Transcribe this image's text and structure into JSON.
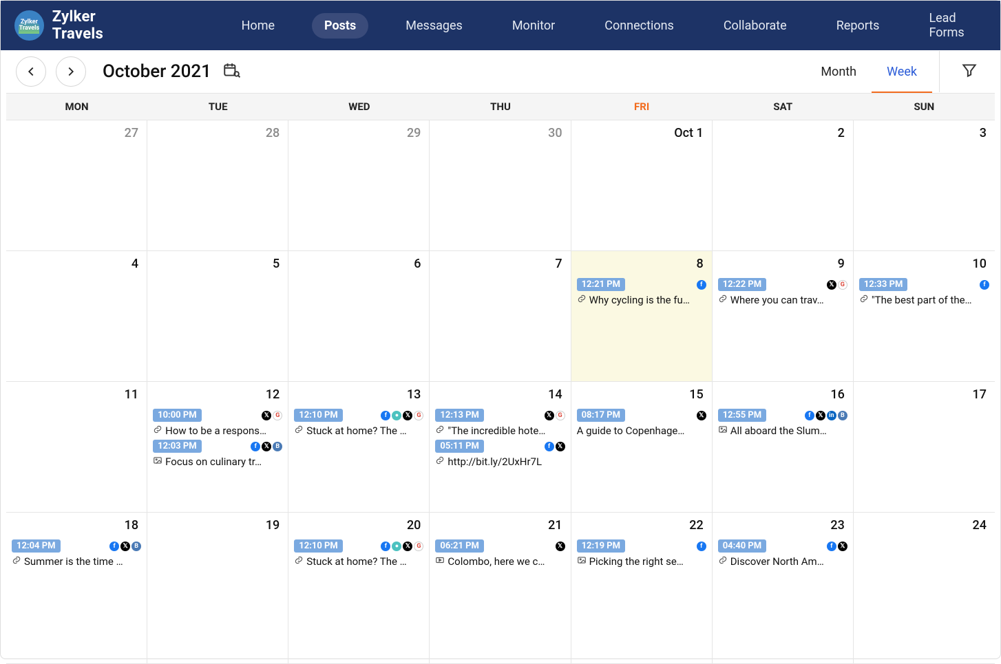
{
  "brand": {
    "name": "Zylker Travels",
    "logo_text": "Zylker Travels"
  },
  "nav": {
    "items": [
      "Home",
      "Posts",
      "Messages",
      "Monitor",
      "Connections",
      "Collaborate",
      "Reports",
      "Lead Forms"
    ],
    "active_index": 1
  },
  "subbar": {
    "title": "October 2021",
    "view_month": "Month",
    "view_week": "Week",
    "active_view_index": 1
  },
  "weekdays": [
    "MON",
    "TUE",
    "WED",
    "THU",
    "FRI",
    "SAT",
    "SUN"
  ],
  "today_weekday_index": 4,
  "grid": [
    [
      {
        "date": "27",
        "current": false,
        "posts": []
      },
      {
        "date": "28",
        "current": false,
        "posts": []
      },
      {
        "date": "29",
        "current": false,
        "posts": []
      },
      {
        "date": "30",
        "current": false,
        "posts": []
      },
      {
        "date": "Oct 1",
        "current": true,
        "posts": []
      },
      {
        "date": "2",
        "current": true,
        "posts": []
      },
      {
        "date": "3",
        "current": true,
        "posts": []
      }
    ],
    [
      {
        "date": "4",
        "current": true,
        "posts": []
      },
      {
        "date": "5",
        "current": true,
        "posts": []
      },
      {
        "date": "6",
        "current": true,
        "posts": []
      },
      {
        "date": "7",
        "current": true,
        "posts": []
      },
      {
        "date": "8",
        "current": true,
        "highlight": true,
        "posts": [
          {
            "time": "12:21 PM",
            "icons": [
              "fb"
            ],
            "icon": "link",
            "text": "Why cycling is the fu…"
          }
        ]
      },
      {
        "date": "9",
        "current": true,
        "posts": [
          {
            "time": "12:22 PM",
            "icons": [
              "x",
              "g"
            ],
            "icon": "link",
            "text": "Where you can trav…"
          }
        ]
      },
      {
        "date": "10",
        "current": true,
        "posts": [
          {
            "time": "12:33 PM",
            "icons": [
              "fb"
            ],
            "icon": "link",
            "text": "\"The best part of the…"
          }
        ]
      }
    ],
    [
      {
        "date": "11",
        "current": true,
        "posts": []
      },
      {
        "date": "12",
        "current": true,
        "posts": [
          {
            "time": "10:00 PM",
            "icons": [
              "x",
              "g"
            ],
            "icon": "link",
            "text": "How to be a respons…"
          },
          {
            "time": "12:03 PM",
            "icons": [
              "fb",
              "x",
              "b"
            ],
            "icon": "image",
            "text": "Focus on culinary tr…"
          }
        ]
      },
      {
        "date": "13",
        "current": true,
        "posts": [
          {
            "time": "12:10 PM",
            "icons": [
              "fb",
              "gr",
              "x",
              "g"
            ],
            "icon": "link",
            "text": "Stuck at home? The …"
          }
        ]
      },
      {
        "date": "14",
        "current": true,
        "posts": [
          {
            "time": "12:13 PM",
            "icons": [
              "x",
              "g"
            ],
            "icon": "link",
            "text": "\"The incredible hote…"
          },
          {
            "time": "05:11 PM",
            "icons": [
              "fb",
              "x"
            ],
            "icon": "link",
            "text": "http://bit.ly/2UxHr7L"
          }
        ]
      },
      {
        "date": "15",
        "current": true,
        "posts": [
          {
            "time": "08:17 PM",
            "icons": [
              "x"
            ],
            "icon": "none",
            "text": "A guide to Copenhage…"
          }
        ]
      },
      {
        "date": "16",
        "current": true,
        "posts": [
          {
            "time": "12:55 PM",
            "icons": [
              "fb",
              "x",
              "in",
              "b"
            ],
            "icon": "image",
            "text": "All aboard the Slum…"
          }
        ]
      },
      {
        "date": "17",
        "current": true,
        "posts": []
      }
    ],
    [
      {
        "date": "18",
        "current": true,
        "posts": [
          {
            "time": "12:04 PM",
            "icons": [
              "fb",
              "x",
              "b"
            ],
            "icon": "link",
            "text": "Summer is the time …"
          }
        ]
      },
      {
        "date": "19",
        "current": true,
        "posts": []
      },
      {
        "date": "20",
        "current": true,
        "posts": [
          {
            "time": "12:10 PM",
            "icons": [
              "fb",
              "gr",
              "x",
              "g"
            ],
            "icon": "link",
            "text": "Stuck at home? The …"
          }
        ]
      },
      {
        "date": "21",
        "current": true,
        "posts": [
          {
            "time": "06:21 PM",
            "icons": [
              "x"
            ],
            "icon": "video",
            "text": "Colombo, here we c…"
          }
        ]
      },
      {
        "date": "22",
        "current": true,
        "posts": [
          {
            "time": "12:19 PM",
            "icons": [
              "fb"
            ],
            "icon": "image",
            "text": "Picking the right se…"
          }
        ]
      },
      {
        "date": "23",
        "current": true,
        "posts": [
          {
            "time": "04:40 PM",
            "icons": [
              "fb",
              "x"
            ],
            "icon": "link",
            "text": "Discover North Am…"
          }
        ]
      },
      {
        "date": "24",
        "current": true,
        "posts": []
      }
    ]
  ]
}
